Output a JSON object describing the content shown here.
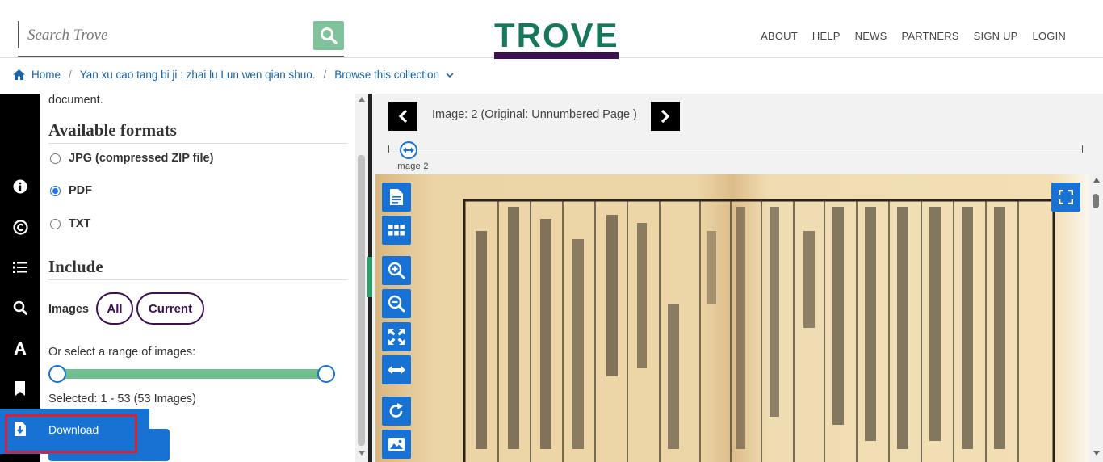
{
  "search": {
    "placeholder": "Search Trove"
  },
  "logo": {
    "text": "TROVE"
  },
  "nav": {
    "items": [
      "ABOUT",
      "HELP",
      "NEWS",
      "PARTNERS",
      "SIGN UP",
      "LOGIN"
    ]
  },
  "breadcrumb": {
    "home": "Home",
    "sep1": "/",
    "title": "Yan xu cao tang bi ji : zhai lu Lun wen qian shuo.",
    "sep2": "/",
    "browse": "Browse this collection"
  },
  "panel": {
    "intro_tail": "document.",
    "formats_heading": "Available formats",
    "formats": [
      {
        "label": "JPG (compressed ZIP file)",
        "selected": false
      },
      {
        "label": "PDF",
        "selected": true
      },
      {
        "label": "TXT",
        "selected": false
      }
    ],
    "include_heading": "Include",
    "images_label": "Images",
    "all_label": "All",
    "current_label": "Current",
    "range_label": "Or select a range of images:",
    "range": {
      "min": 1,
      "max": 53,
      "selected_start": 1,
      "selected_end": 53
    },
    "selected_text": "Selected: 1 - 53 (53 Images)",
    "download_label": "Download"
  },
  "viewer": {
    "image_label": "Image: 2 (Original: Unnumbered Page )",
    "timeline_marker_label": "Image  2"
  },
  "colors": {
    "brand_green": "#16785a",
    "brand_purple": "#3c1053",
    "accent_blue": "#1872d4",
    "range_green": "#6fbf8f",
    "highlight_red": "#e11d2a"
  }
}
